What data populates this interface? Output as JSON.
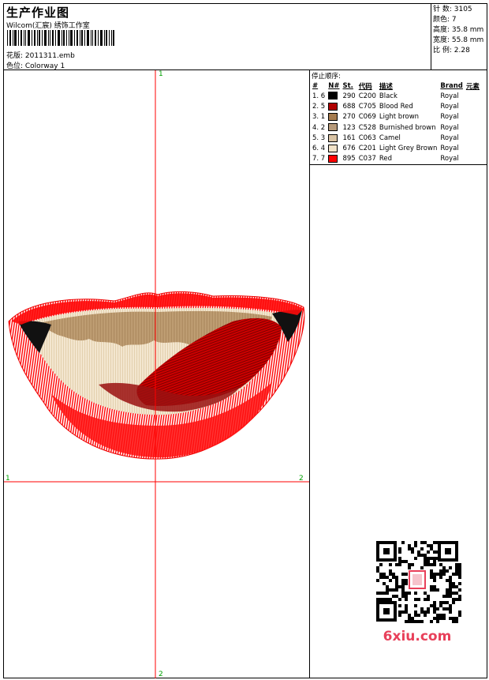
{
  "header": {
    "title": "生产作业图",
    "studio": "Wilcom(汇宸) 绣饰工作室",
    "file_line": "花版: 2011311.emb",
    "colorway_line": "色位: Colorway 1"
  },
  "stats": {
    "stitches": "针 数: 3105",
    "colors": "颜色: 7",
    "height": "高度: 35.8 mm",
    "width": "宽度: 55.8 mm",
    "scale": "比 例: 2.28"
  },
  "stop_sequence": {
    "title": "停止顺序:",
    "headers": [
      "#",
      "N#",
      "St.",
      "代码",
      "描述",
      "Brand",
      "元素"
    ],
    "rows": [
      {
        "seq": "1. 6",
        "st": "290",
        "code": "C200",
        "desc": "Black",
        "brand": "Royal",
        "color": "#000000"
      },
      {
        "seq": "2. 5",
        "st": "688",
        "code": "C705",
        "desc": "Blood Red",
        "brand": "Royal",
        "color": "#b00000"
      },
      {
        "seq": "3. 1",
        "st": "270",
        "code": "C069",
        "desc": "Light brown",
        "brand": "Royal",
        "color": "#a57b4e"
      },
      {
        "seq": "4. 2",
        "st": "123",
        "code": "C528",
        "desc": "Burnished brown",
        "brand": "Royal",
        "color": "#b79a7a"
      },
      {
        "seq": "5. 3",
        "st": "161",
        "code": "C063",
        "desc": "Camel",
        "brand": "Royal",
        "color": "#d9c3a4"
      },
      {
        "seq": "6. 4",
        "st": "676",
        "code": "C201",
        "desc": "Light Grey Brown",
        "brand": "Royal",
        "color": "#f1e2c8"
      },
      {
        "seq": "7. 7",
        "st": "895",
        "code": "C037",
        "desc": "Red",
        "brand": "Royal",
        "color": "#ff0000"
      }
    ]
  },
  "axis_labels": {
    "top": "1",
    "bottom": "2",
    "left": "1",
    "right": "2"
  },
  "watermark": {
    "text": "6xiu.com",
    "color": "#e8405a"
  }
}
